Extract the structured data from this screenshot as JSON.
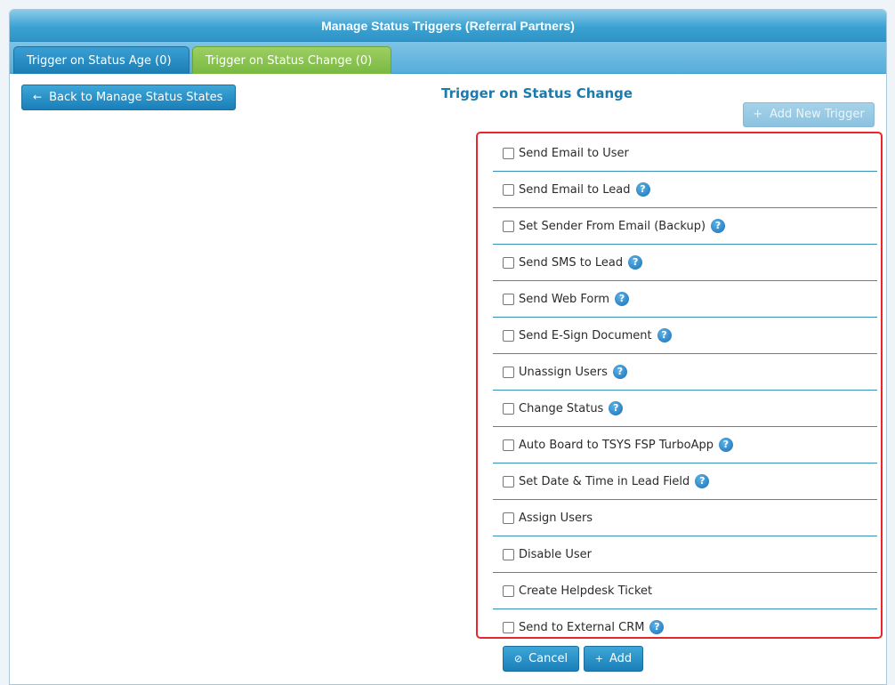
{
  "window": {
    "title": "Manage Status Triggers (Referral Partners)"
  },
  "tabs": [
    {
      "label": "Trigger on Status Age (0)"
    },
    {
      "label": "Trigger on Status Change (0)"
    }
  ],
  "toolbar": {
    "back_label": "Back to Manage Status States",
    "back_icon": "←",
    "add_new_label": "Add New Trigger",
    "add_new_icon": "+"
  },
  "section": {
    "title": "Trigger on Status Change"
  },
  "triggers": [
    {
      "label": "Send Email to User",
      "help": false
    },
    {
      "label": "Send Email to Lead",
      "help": true
    },
    {
      "label": "Set Sender From Email (Backup)",
      "help": true
    },
    {
      "label": "Send SMS to Lead",
      "help": true
    },
    {
      "label": "Send Web Form",
      "help": true
    },
    {
      "label": "Send E-Sign Document",
      "help": true
    },
    {
      "label": "Unassign Users",
      "help": true
    },
    {
      "label": "Change Status",
      "help": true
    },
    {
      "label": "Auto Board to TSYS FSP TurboApp",
      "help": true
    },
    {
      "label": "Set Date & Time in Lead Field",
      "help": true
    },
    {
      "label": "Assign Users",
      "help": false
    },
    {
      "label": "Disable User",
      "help": false
    },
    {
      "label": "Create Helpdesk Ticket",
      "help": false
    },
    {
      "label": "Send to External CRM",
      "help": true
    }
  ],
  "help_glyph": "?",
  "footer": {
    "cancel_label": "Cancel",
    "cancel_icon": "⊘",
    "add_label": "Add",
    "add_icon": "+"
  },
  "colors": {
    "accent": "#1d7aaa",
    "tab_active": "#7ab842",
    "highlight_border": "#e8262e"
  }
}
